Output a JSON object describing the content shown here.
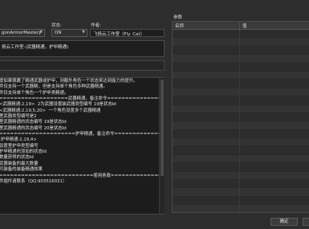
{
  "top": {
    "name_value": "gonArmorMastery",
    "state_label": "状态:",
    "state_value": "ON",
    "author_label": "作者:",
    "author_value": "飞扬云工作室（Fly_Cat）",
    "desc_value": "扬云工作室-(武器精通，护甲精通)"
  },
  "params": {
    "title": "参数",
    "col_name": "名称",
    "col_value": "值"
  },
  "help_lines": [
    "提如果佩戴了精通武器或护甲，则额外角色一个状态来达到能力的提升。",
    "件仅支持一个武器精，但是支持单个角色多种武器精通。",
    "件仅支持单个角色一个护甲类精通。",
    "===================武器精通，备注命令=====================",
    "<武器精通:2,19>  2为武器设置装武器类型编号 19是状态Id",
    "<武器精通:2,19,5,20>  一个角色设置多个武器精通",
    "里武器类型编号是2",
    "里武器精通的状态编号 19是状态Id",
    "里武器精通的状态编号 20是状态Id",
    "=====================护甲精通，备注命令==================",
    ":护甲精通:2,19,4>",
    "设置里护甲类型编号",
    "护甲精通时添加的状态Id",
    "数量获得的状态Id",
    "武器装备的最大数量",
    "可装备的装备精通效果",
    "==========================使用条款=======================",
    "件插件请联系（QQ:903516031）"
  ],
  "footer": {
    "ok_label": "确定"
  }
}
